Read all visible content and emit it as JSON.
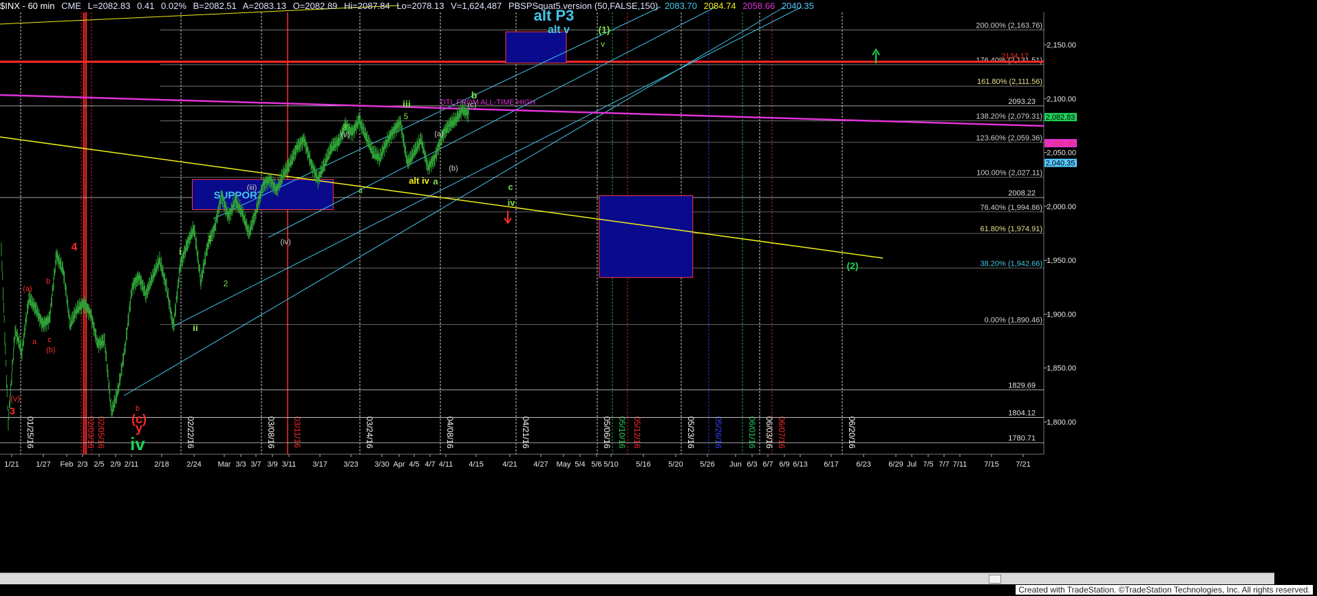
{
  "header": {
    "symbol": "$INX - 60 min",
    "exchange": "CME",
    "last": "L=2082.83",
    "change": "0.41",
    "change_pct": "0.02%",
    "bid": "B=2082.51",
    "ask": "A=2083.13",
    "open": "O=2082.89",
    "high": "Hi=2087.84",
    "low": "Lo=2078.13",
    "volume": "V=1,624,487",
    "study": "PBSPSquat5.version (50,FALSE,150)",
    "study_values": [
      "2083.70",
      "2084.74",
      "2058.66",
      "2040.35"
    ]
  },
  "credit": "Created with TradeStation. ©TradeStation Technologies, Inc. All rights reserved.",
  "colors": {
    "background": "#000000",
    "price_bars": "#2fa236",
    "fib_lines": "#bfbfbf",
    "channel": "#43c6e8",
    "dtl": "#e033d9",
    "trend": "#f2f01b",
    "resistance": "#ff2a2a",
    "zone_fill": "#0a0a8c",
    "zone_edge": "#ff3b3b"
  },
  "chart_data": {
    "type": "candlestick",
    "interval": "60 min",
    "ylim": [
      1770,
      2180
    ],
    "y_ticks": [
      1800,
      1850,
      1900,
      1950,
      2000,
      2050,
      2100,
      2150
    ],
    "y_tick_labels": [
      "1,800.00",
      "1,850.00",
      "1,900.00",
      "1,950.00",
      "2,000.00",
      "2,050.00",
      "2,100.00",
      "2,150.00"
    ],
    "x_tick_labels": [
      "1/21",
      "1/27",
      "Feb",
      "2/3",
      "2/5",
      "2/9",
      "2/11",
      "2/18",
      "2/24",
      "Mar",
      "3/3",
      "3/7",
      "3/9",
      "3/11",
      "3/17",
      "3/23",
      "3/30",
      "Apr",
      "4/5",
      "4/7",
      "4/11",
      "4/15",
      "4/21",
      "4/27",
      "May",
      "5/4",
      "5/6",
      "5/10",
      "5/16",
      "5/20",
      "5/26",
      "Jun",
      "6/3",
      "6/7",
      "6/9",
      "6/13",
      "6/17",
      "6/23",
      "6/29",
      "Jul",
      "7/5",
      "7/7",
      "7/11",
      "7/15",
      "7/21"
    ],
    "price_path": [
      [
        1960,
        1800
      ],
      [
        1885,
        1865
      ],
      [
        1915,
        1905
      ],
      [
        1890,
        1895
      ],
      [
        1955,
        1940
      ],
      [
        1890,
        1905
      ],
      [
        1910,
        1900
      ],
      [
        1872,
        1875
      ],
      [
        1808,
        1830
      ],
      [
        1870,
        1925
      ],
      [
        1935,
        1918
      ],
      [
        1935,
        1950
      ],
      [
        1925,
        1888
      ],
      [
        1945,
        1965
      ],
      [
        1980,
        1930
      ],
      [
        1965,
        1980
      ],
      [
        2010,
        1990
      ],
      [
        2005,
        1994
      ],
      [
        1975,
        1995
      ],
      [
        2020,
        2025
      ],
      [
        2015,
        2030
      ],
      [
        2040,
        2055
      ],
      [
        2062,
        2040
      ],
      [
        2025,
        2040
      ],
      [
        2055,
        2060
      ],
      [
        2075,
        2068
      ],
      [
        2080,
        2065
      ],
      [
        2050,
        2045
      ],
      [
        2060,
        2070
      ],
      [
        2078,
        2040
      ],
      [
        2050,
        2062
      ],
      [
        2036,
        2045
      ],
      [
        2065,
        2075
      ],
      [
        2080,
        2090
      ],
      [
        2085
      ]
    ],
    "fib_levels": [
      {
        "label": "200.00% (2,163.76)",
        "value": 2163.76
      },
      {
        "label": "176.40% (2,131.51)",
        "value": 2131.51
      },
      {
        "label": "161.80% (2,111.56)",
        "value": 2111.56
      },
      {
        "label": "138.20% (2,079.31)",
        "value": 2079.31
      },
      {
        "label": "123.60% (2,059.36)",
        "value": 2059.36
      },
      {
        "label": "100.00% (2,027.11)",
        "value": 2027.11
      },
      {
        "label": "76.40% (1,994.86)",
        "value": 1994.86
      },
      {
        "label": "61.80% (1,974.91)",
        "value": 1974.91
      },
      {
        "label": "38.20% (1,942.66)",
        "value": 1942.66
      },
      {
        "label": "0.00% (1,890.46)",
        "value": 1890.46
      }
    ],
    "horizontal_levels": [
      {
        "label": "2093.23",
        "value": 2093.23
      },
      {
        "label": "2008.22",
        "value": 2008.22
      },
      {
        "label": "1829.69",
        "value": 1829.69
      },
      {
        "label": "1804.12",
        "value": 1804.12
      },
      {
        "label": "1780.71",
        "value": 1780.71
      }
    ],
    "resistance_label": "2134.17",
    "resistance_value": 2134.17,
    "price_tags": [
      {
        "label": "2,082.83",
        "value": 2082.83,
        "color": "#1fd158",
        "text_color": "#000"
      },
      {
        "label": "2,058.66",
        "value": 2058.66,
        "color": "#e033d9",
        "text_color": "#ff2a2a"
      },
      {
        "label": "2,040.35",
        "value": 2040.35,
        "color": "#55c8ff",
        "text_color": "#000"
      }
    ],
    "date_markers": [
      {
        "label": "01/25/16",
        "color": "#ffffff"
      },
      {
        "label": "02/03/16",
        "color": "#ff2a2a"
      },
      {
        "label": "02/05/16",
        "color": "#ff2a2a"
      },
      {
        "label": "02/22/16",
        "color": "#ffffff"
      },
      {
        "label": "03/08/16",
        "color": "#ffffff"
      },
      {
        "label": "03/11/16",
        "color": "#ff2a2a"
      },
      {
        "label": "03/24/16",
        "color": "#ffffff"
      },
      {
        "label": "04/08/16",
        "color": "#ffffff"
      },
      {
        "label": "04/21/16",
        "color": "#ffffff"
      },
      {
        "label": "05/06/16",
        "color": "#ffffff"
      },
      {
        "label": "05/10/16",
        "color": "#1fd158"
      },
      {
        "label": "05/12/16",
        "color": "#ff2a2a"
      },
      {
        "label": "05/23/16",
        "color": "#ffffff"
      },
      {
        "label": "05/26/16",
        "color": "#3146ff"
      },
      {
        "label": "06/01/16",
        "color": "#1fd158"
      },
      {
        "label": "06/03/16",
        "color": "#ffffff"
      },
      {
        "label": "06/07/16",
        "color": "#ff2a2a"
      },
      {
        "label": "06/20/16",
        "color": "#ffffff"
      }
    ],
    "zones": [
      {
        "name": "alt-v-target",
        "x": [
          38.4,
          43.0
        ],
        "y": [
          2133,
          2162
        ]
      },
      {
        "name": "support",
        "x": [
          14.6,
          25.3
        ],
        "y": [
          1997,
          2025
        ],
        "label": "SUPPORT"
      },
      {
        "name": "wave-2-target",
        "x": [
          45.5,
          52.6
        ],
        "y": [
          1934,
          2010
        ]
      }
    ],
    "annotations": [
      {
        "text": "alt  P3",
        "color": "#43c6e8",
        "size": 22
      },
      {
        "text": "alt v",
        "color": "#43c6e8",
        "size": 16
      },
      {
        "text": "(1)",
        "color": "#7ee24a",
        "size": 14
      },
      {
        "text": "v",
        "color": "#7ee24a",
        "size": 12
      },
      {
        "text": "DTL FROM ALL-TIME HIGH",
        "color": "#e033d9",
        "size": 11
      },
      {
        "text": "b",
        "color": "#7ee24a",
        "size": 14
      },
      {
        "text": "(c)",
        "color": "#d0d0d0",
        "size": 11
      },
      {
        "text": "iii",
        "color": "#7ee24a",
        "size": 14
      },
      {
        "text": "5",
        "color": "#7ee24a",
        "size": 12
      },
      {
        "text": "3",
        "color": "#7ee24a",
        "size": 12
      },
      {
        "text": "(v)",
        "color": "#d0d0d0",
        "size": 11
      },
      {
        "text": "(a)",
        "color": "#d0d0d0",
        "size": 11
      },
      {
        "text": "(b)",
        "color": "#d0d0d0",
        "size": 11
      },
      {
        "text": "alt iv",
        "color": "#f2f01b",
        "size": 13
      },
      {
        "text": "a",
        "color": "#7ee24a",
        "size": 13
      },
      {
        "text": "4",
        "color": "#7ee24a",
        "size": 11
      },
      {
        "text": "c",
        "color": "#7ee24a",
        "size": 13
      },
      {
        "text": "iv",
        "color": "#7ee24a",
        "size": 13
      },
      {
        "text": "(iii)",
        "color": "#d0d0d0",
        "size": 11
      },
      {
        "text": "(iv)",
        "color": "#d0d0d0",
        "size": 11
      },
      {
        "text": "i",
        "color": "#7ee24a",
        "size": 14
      },
      {
        "text": "1",
        "color": "#7ee24a",
        "size": 11
      },
      {
        "text": "2",
        "color": "#7ee24a",
        "size": 12
      },
      {
        "text": "ii",
        "color": "#7ee24a",
        "size": 14
      },
      {
        "text": "4",
        "color": "#ff2a2a",
        "size": 16
      },
      {
        "text": "(a)",
        "color": "#ff2a2a",
        "size": 11
      },
      {
        "text": "b",
        "color": "#ff2a2a",
        "size": 11
      },
      {
        "text": "a",
        "color": "#ff2a2a",
        "size": 11
      },
      {
        "text": "c",
        "color": "#ff2a2a",
        "size": 11
      },
      {
        "text": "(b)",
        "color": "#ff2a2a",
        "size": 11
      },
      {
        "text": "(v)",
        "color": "#ff2a2a",
        "size": 12
      },
      {
        "text": "3",
        "color": "#ff2a2a",
        "size": 14
      },
      {
        "text": "b",
        "color": "#ff2a2a",
        "size": 11
      },
      {
        "text": "(c)",
        "color": "#ff2a2a",
        "size": 18
      },
      {
        "text": "y",
        "color": "#ff2a2a",
        "size": 18
      },
      {
        "text": "iv",
        "color": "#1fd158",
        "size": 26
      },
      {
        "text": "(2)",
        "color": "#1fd158",
        "size": 14
      }
    ],
    "arrows": [
      {
        "direction": "up",
        "color": "#1fd158"
      },
      {
        "direction": "down",
        "color": "#ff2a2a"
      }
    ]
  }
}
